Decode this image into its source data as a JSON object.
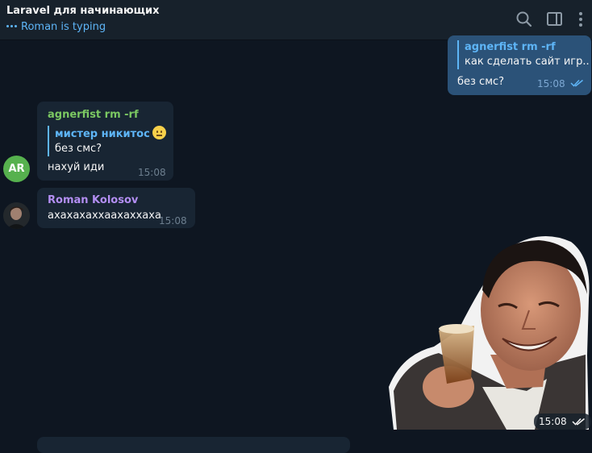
{
  "header": {
    "title": "Laravel для начинающих",
    "status": "Roman is typing"
  },
  "icons": {
    "search": "search-icon",
    "sidebar": "sidebar-toggle-icon",
    "more": "more-vertical-icon",
    "read": "double-check-icon"
  },
  "colors": {
    "background": "#0e1621",
    "header": "#17212b",
    "incoming_bubble": "#182533",
    "outgoing_bubble": "#2b5278",
    "accent": "#5eb5f7",
    "agnerfist_name": "#7bc862",
    "roman_name": "#b38ef2"
  },
  "messages": [
    {
      "direction": "out",
      "reply_to": {
        "name": "agnerfist rm -rf",
        "text": "как сделать сайт игр..."
      },
      "text": "без смс?",
      "time": "15:08",
      "read": true
    },
    {
      "direction": "in",
      "sender": "agnerfist rm -rf",
      "avatar_initials": "AR",
      "reply_to": {
        "name": "мистер никитос",
        "text": "без смс?"
      },
      "text": "нахуй иди",
      "time": "15:08"
    },
    {
      "direction": "in",
      "sender": "Roman Kolosov",
      "text": "ахахахаххаахаххаха",
      "time": "15:08"
    },
    {
      "direction": "out",
      "type": "sticker",
      "time": "15:08",
      "read": true
    }
  ]
}
